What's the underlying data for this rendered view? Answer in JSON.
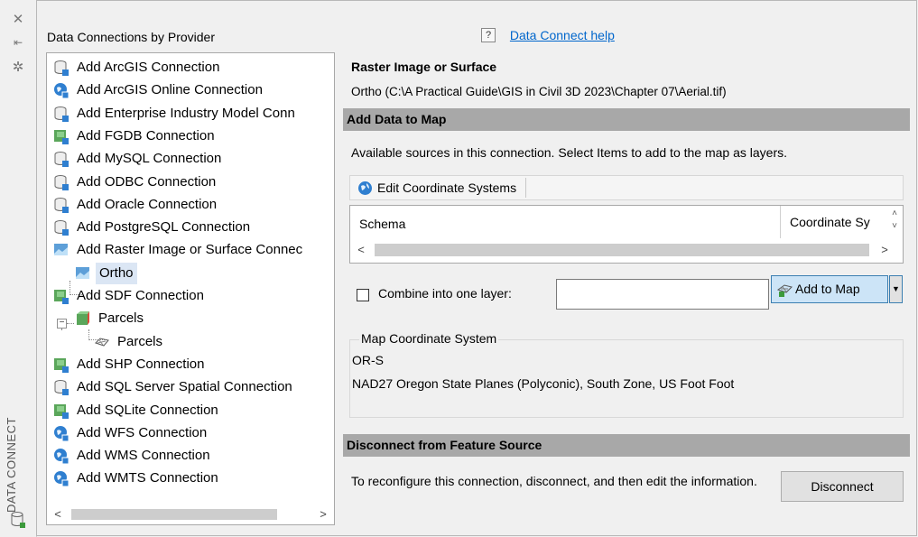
{
  "sidebar": {
    "vertical_title": "DATA CONNECT"
  },
  "tree": {
    "title": "Data Connections by Provider",
    "items": [
      {
        "label": "Add ArcGIS Connection",
        "icon": "db-icon"
      },
      {
        "label": "Add ArcGIS Online Connection",
        "icon": "globe-icon"
      },
      {
        "label": "Add Enterprise Industry Model Conn",
        "icon": "db-icon"
      },
      {
        "label": "Add FGDB Connection",
        "icon": "file-icon"
      },
      {
        "label": "Add MySQL Connection",
        "icon": "db-icon"
      },
      {
        "label": "Add ODBC Connection",
        "icon": "db-icon"
      },
      {
        "label": "Add Oracle Connection",
        "icon": "db-icon"
      },
      {
        "label": "Add PostgreSQL Connection",
        "icon": "db-icon"
      },
      {
        "label": "Add Raster Image or Surface Connec",
        "icon": "raster-icon"
      },
      {
        "label": "Ortho",
        "icon": "raster-icon"
      },
      {
        "label": "Add SDF Connection",
        "icon": "file-icon"
      },
      {
        "label": "Parcels",
        "icon": "cube-icon"
      },
      {
        "label": "Parcels",
        "icon": "polygon-icon"
      },
      {
        "label": "Add SHP Connection",
        "icon": "file-icon"
      },
      {
        "label": "Add SQL Server Spatial Connection",
        "icon": "db-icon"
      },
      {
        "label": "Add SQLite Connection",
        "icon": "file-icon"
      },
      {
        "label": "Add WFS Connection",
        "icon": "globe-icon"
      },
      {
        "label": "Add WMS Connection",
        "icon": "globe-icon"
      },
      {
        "label": "Add WMTS Connection",
        "icon": "globe-icon"
      }
    ]
  },
  "help": {
    "link": "Data Connect help"
  },
  "source": {
    "title": "Raster Image or Surface",
    "path": "Ortho (C:\\A Practical Guide\\GIS in Civil 3D 2023\\Chapter 07\\Aerial.tif)"
  },
  "add_data": {
    "header": "Add Data to Map",
    "description": "Available sources in this connection.  Select Items to add to the map as layers.",
    "edit_cs_button": "Edit Coordinate Systems",
    "columns": [
      "Schema",
      "Coordinate Sy"
    ],
    "combine_label": "Combine into one layer:",
    "combine_value": "",
    "add_button": "Add to Map"
  },
  "map_cs": {
    "legend": "Map Coordinate System",
    "code": "OR-S",
    "description": "NAD27 Oregon State Planes (Polyconic), South Zone, US Foot Foot"
  },
  "disconnect": {
    "header": "Disconnect from Feature Source",
    "description": "To reconfigure this connection, disconnect, and then edit the information.",
    "button": "Disconnect"
  },
  "colors": {
    "header_bar": "#a8a8a8",
    "link": "#0066cc",
    "selected_row": "#dbe6f4",
    "add_button_bg": "#cce4f7"
  }
}
